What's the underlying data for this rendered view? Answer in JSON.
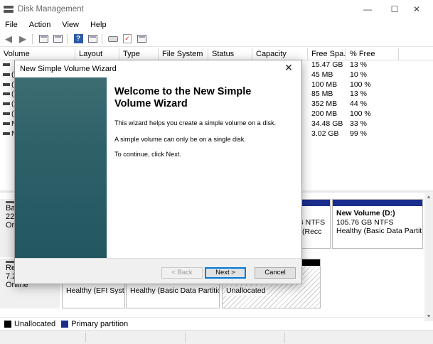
{
  "window": {
    "title": "Disk Management",
    "minimize_glyph": "—",
    "maximize_glyph": "☐",
    "close_glyph": "✕"
  },
  "menu": [
    "File",
    "Action",
    "View",
    "Help"
  ],
  "toolbar": {
    "icons": [
      "back-icon",
      "forward-icon",
      "disk-list-icon",
      "properties-icon",
      "help-icon",
      "key-icon",
      "checklist-icon",
      "console-icon"
    ]
  },
  "volume_table": {
    "headers": [
      "Volume",
      "Layout",
      "Type",
      "File System",
      "Status",
      "Capacity",
      "Free Spa...",
      "% Free"
    ],
    "rows": [
      {
        "volume": "",
        "free": "15.47 GB",
        "pct": "13 %"
      },
      {
        "volume": "(",
        "free": "45 MB",
        "pct": "10 %"
      },
      {
        "volume": "(",
        "free": "100 MB",
        "pct": "100 %"
      },
      {
        "volume": "(",
        "free": "85 MB",
        "pct": "13 %"
      },
      {
        "volume": "(",
        "free": "352 MB",
        "pct": "44 %"
      },
      {
        "volume": "(",
        "free": "200 MB",
        "pct": "100 %"
      },
      {
        "volume": "N",
        "free": "34.48 GB",
        "pct": "33 %"
      },
      {
        "volume": "N",
        "free": "3.02 GB",
        "pct": "99 %"
      }
    ]
  },
  "disks": [
    {
      "label_lines": [
        "Ba",
        "223",
        "Onl"
      ],
      "partitions": [
        {
          "lines": [
            "MB NTFS",
            "hy (Recc"
          ]
        },
        {
          "lines": [
            "New Volume  (D:)",
            "105.76 GB NTFS",
            "Healthy (Basic Data Partitic"
          ]
        }
      ]
    },
    {
      "label_lines": [
        "Re",
        "7.2",
        "Online"
      ],
      "partitions": [
        {
          "lines": [
            "Healthy (EFI Syste"
          ]
        },
        {
          "lines": [
            "Healthy (Basic Data Partition"
          ]
        },
        {
          "lines": [
            "Unallocated"
          ]
        }
      ]
    }
  ],
  "legend": [
    {
      "label": "Unallocated",
      "color": "#000000"
    },
    {
      "label": "Primary partition",
      "color": "#1b2d8c"
    }
  ],
  "wizard": {
    "title": "New Simple Volume Wizard",
    "close_glyph": "✕",
    "heading": "Welcome to the New Simple Volume Wizard",
    "paragraphs": [
      "This wizard helps you create a simple volume on a disk.",
      "A simple volume can only be on a single disk.",
      "To continue, click Next."
    ],
    "buttons": {
      "back": "< Back",
      "next": "Next >",
      "cancel": "Cancel"
    }
  }
}
